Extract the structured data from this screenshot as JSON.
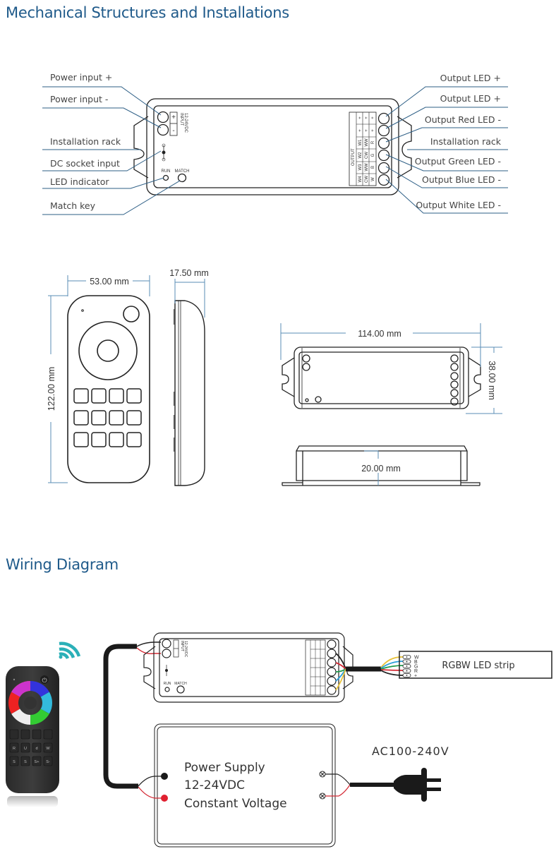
{
  "sections": {
    "mechanical_title": "Mechanical Structures and Installations",
    "wiring_title": "Wiring Diagram"
  },
  "controller": {
    "left_labels": [
      "Power input +",
      "Power input -",
      "Installation rack",
      "DC socket input",
      "LED indicator",
      "Match key"
    ],
    "right_labels": [
      "Output LED +",
      "Output LED +",
      "Output Red LED -",
      "Installation rack",
      "Output Green LED -",
      "Output Blue LED -",
      "Output White LED -"
    ],
    "input_text_1": "INPUT",
    "input_text_2": "12-24VDC",
    "plus": "+",
    "minus": "-",
    "run_label": "RUN",
    "match_label": "MATCH",
    "output_label": "OUTPUT",
    "output_table": [
      [
        "+",
        "+",
        "+"
      ],
      [
        "+",
        "+",
        "+"
      ],
      [
        "W1",
        "WW",
        "R"
      ],
      [
        "W2",
        "CW",
        "G"
      ],
      [
        "W3",
        "WW",
        "B"
      ],
      [
        "W4",
        "CW",
        "W"
      ]
    ]
  },
  "dimensions": {
    "remote_width": "53.00 mm",
    "remote_depth": "17.50 mm",
    "remote_height": "122.00 mm",
    "controller_length": "114.00 mm",
    "controller_width": "38.00 mm",
    "controller_height": "20.00 mm"
  },
  "wiring": {
    "led_strip_label": "RGBW LED strip",
    "strip_pins": [
      "W",
      "B",
      "G",
      "R",
      "+"
    ],
    "power_supply_lines": [
      "Power Supply",
      "12-24VDC",
      "Constant Voltage"
    ],
    "ac_label": "AC100-240V",
    "remote_button_labels": [
      "",
      "",
      "",
      "",
      "R",
      "U",
      "d",
      "W",
      "S",
      "S",
      "S+",
      "S-"
    ]
  },
  "colors": {
    "heading": "#1f5a8a",
    "leader": "#2e5f86",
    "wifi": "#2bb0b8",
    "wire_red": "#d42a35",
    "wire_green": "#1f9a4a",
    "wire_blue": "#2a9fd8",
    "wire_yellow": "#e8c23a"
  }
}
